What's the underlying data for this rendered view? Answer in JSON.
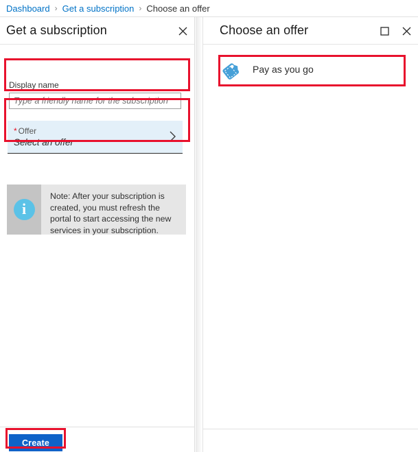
{
  "breadcrumb": {
    "items": [
      {
        "label": "Dashboard",
        "type": "link"
      },
      {
        "label": "Get a subscription",
        "type": "link"
      },
      {
        "label": "Choose an offer",
        "type": "current"
      }
    ],
    "separator": "›"
  },
  "left_blade": {
    "title": "Get a subscription",
    "close_icon": "close-icon",
    "display_name": {
      "label": "Display name",
      "value": "",
      "placeholder": "Type a friendly name for the subscription"
    },
    "offer": {
      "required_marker": "*",
      "label": "Offer",
      "value": "Select an offer",
      "chevron_icon": "chevron-right-icon"
    },
    "note": {
      "icon": "info-icon",
      "text": "Note: After your subscription is created, you must refresh the portal to start accessing the new services in your subscription."
    },
    "create_button": {
      "label": "Create"
    }
  },
  "right_blade": {
    "title": "Choose an offer",
    "maximize_icon": "maximize-icon",
    "close_icon": "close-icon",
    "offers": [
      {
        "label": "Pay as you go",
        "icon": "price-tag-icon"
      }
    ]
  },
  "colors": {
    "link": "#0072c6",
    "annotation": "#e8112d",
    "primary_button": "#0f62c8",
    "field_highlight": "#e3f0f9",
    "info_icon": "#5bc2e7",
    "note_band": "#c4c4c4",
    "note_body": "#e6e6e6",
    "tag_icon": "#46a0d8"
  }
}
